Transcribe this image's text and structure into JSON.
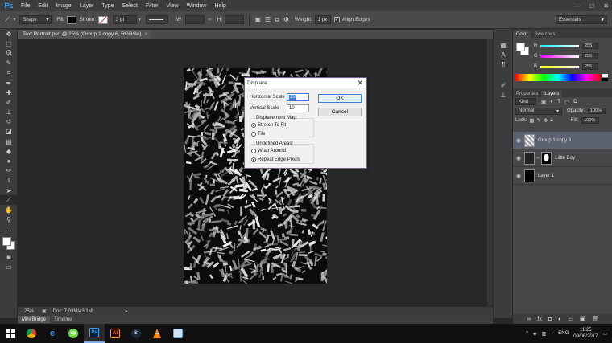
{
  "menubar": {
    "logo": "Ps",
    "items": [
      "File",
      "Edit",
      "Image",
      "Layer",
      "Type",
      "Select",
      "Filter",
      "View",
      "Window",
      "Help"
    ],
    "win_min": "—",
    "win_max": "□",
    "win_close": "✕"
  },
  "options": {
    "mode": "Shape",
    "fill_label": "Fill:",
    "stroke_label": "Stroke:",
    "stroke_size": "3 pt",
    "w_label": "W:",
    "h_label": "H:",
    "weight_label": "Weight:",
    "weight_value": "1 px",
    "align_edges": "Align Edges",
    "workspace": "Essentials"
  },
  "document": {
    "tab_title": "Text Portrait.psd @ 25% (Group 1 copy 6, RGB/8#)",
    "zoom": "25%",
    "doc_info": "Doc: 7.03M/43.1M"
  },
  "bottom_tabs": [
    "Mini Bridge",
    "Timeline"
  ],
  "dialog": {
    "title": "Displace",
    "horizontal_label": "Horizontal Scale",
    "horizontal_value": "10",
    "vertical_label": "Vertical Scale",
    "vertical_value": "10",
    "map_label": "Displacement Map:",
    "map_options": [
      "Stretch To Fit",
      "Tile"
    ],
    "undefined_label": "Undefined Areas:",
    "undefined_options": [
      "Wrap Around",
      "Repeat Edge Pixels"
    ],
    "ok": "OK",
    "cancel": "Cancel"
  },
  "color_panel": {
    "tabs": [
      "Color",
      "Swatches"
    ],
    "r_label": "R",
    "g_label": "G",
    "b_label": "B",
    "r": "255",
    "g": "255",
    "b": "255"
  },
  "layers_panel": {
    "tabs": [
      "Properties",
      "Layers"
    ],
    "filter": "Kind",
    "blend_mode": "Normal",
    "opacity_label": "Opacity:",
    "opacity": "100%",
    "lock_label": "Lock:",
    "fill_label": "Fill:",
    "fill": "100%",
    "layers": [
      "Group 1 copy 6",
      "Little Boy",
      "Layer 1"
    ]
  },
  "taskbar": {
    "lang": "ENG",
    "time": "11:25",
    "date": "09/06/2017"
  },
  "colors": {
    "accent": "#31a8ff",
    "dialog_border": "#7a5a9a",
    "selected_layer": "#5c6170"
  }
}
